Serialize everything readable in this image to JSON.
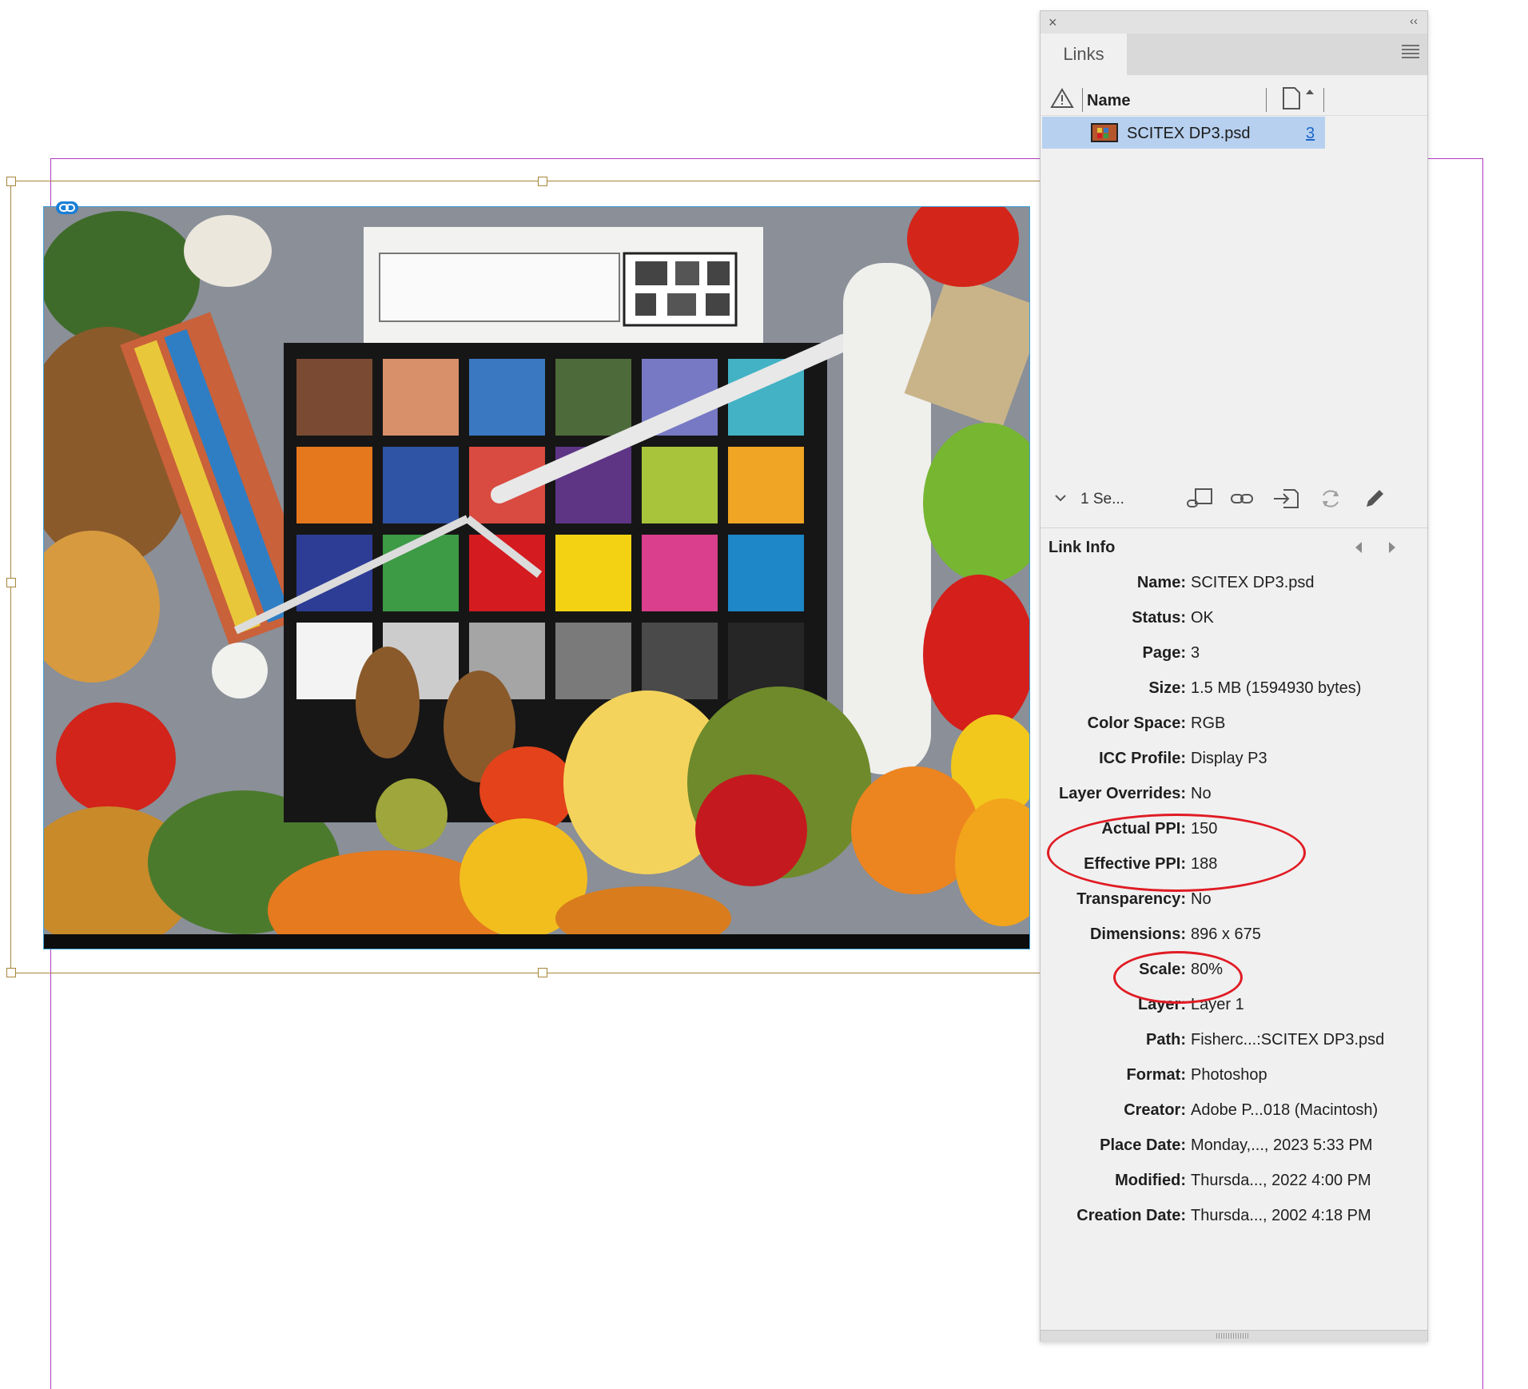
{
  "panel": {
    "tab_label": "Links",
    "close_glyph": "×",
    "collapse_glyph": "‹‹",
    "column_name": "Name",
    "links": [
      {
        "name": "SCITEX DP3.psd",
        "page": "3"
      }
    ],
    "selection_summary": "1 Se..."
  },
  "link_info": {
    "title": "Link Info",
    "rows": [
      {
        "label": "Name:",
        "value": "SCITEX DP3.psd"
      },
      {
        "label": "Status:",
        "value": "OK"
      },
      {
        "label": "Page:",
        "value": "3"
      },
      {
        "label": "Size:",
        "value": "1.5 MB (1594930 bytes)"
      },
      {
        "label": "Color Space:",
        "value": "RGB"
      },
      {
        "label": "ICC Profile:",
        "value": "Display P3"
      },
      {
        "label": "Layer Overrides:",
        "value": "No"
      },
      {
        "label": "Actual PPI:",
        "value": "150"
      },
      {
        "label": "Effective PPI:",
        "value": "188"
      },
      {
        "label": "Transparency:",
        "value": "No"
      },
      {
        "label": "Dimensions:",
        "value": "896 x 675"
      },
      {
        "label": "Scale:",
        "value": "80%"
      },
      {
        "label": "Layer:",
        "value": "Layer 1"
      },
      {
        "label": "Path:",
        "value": "Fisherc...:SCITEX DP3.psd"
      },
      {
        "label": "Format:",
        "value": "Photoshop"
      },
      {
        "label": "Creator:",
        "value": "Adobe P...018 (Macintosh)"
      },
      {
        "label": "Place Date:",
        "value": "Monday,..., 2023 5:33 PM"
      },
      {
        "label": "Modified:",
        "value": "Thursda..., 2022 4:00 PM"
      },
      {
        "label": "Creation Date:",
        "value": "Thursda..., 2002 4:18 PM"
      }
    ]
  },
  "icons": {
    "panel_close": "close-icon",
    "panel_collapse": "double-chevron-left-icon",
    "panel_menu": "hamburger-menu-icon",
    "warning_column": "warning-triangle-icon",
    "page_column": "page-sort-icon",
    "toolbar": [
      "relink-from-cc-icon",
      "relink-icon",
      "goto-link-icon",
      "update-link-icon",
      "edit-original-icon"
    ]
  },
  "colors": {
    "selection": "#b7d0ef",
    "page_link": "#1b66c9",
    "annotation": "#e01b24",
    "frame": "#a8853a",
    "guide": "#b23cc2",
    "image_border": "#3aa0d8"
  }
}
